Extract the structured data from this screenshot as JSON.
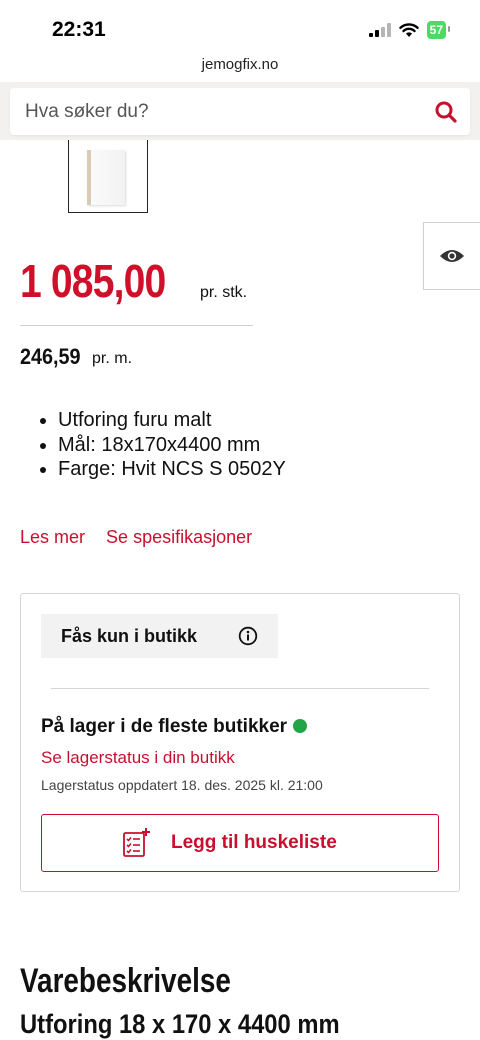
{
  "status_bar": {
    "time": "22:31",
    "battery": "57"
  },
  "browser": {
    "url": "jemogfix.no"
  },
  "search": {
    "placeholder": "Hva søker du?"
  },
  "product": {
    "price": "1 085,00",
    "price_unit": "pr. stk.",
    "price_per_meter": "246,59",
    "price_per_meter_unit": "pr. m.",
    "features": [
      "Utforing furu malt",
      "Mål: 18x170x4400 mm",
      "Farge: Hvit NCS S 0502Y"
    ],
    "links": {
      "read_more": "Les mer",
      "specifications": "Se spesifikasjoner"
    }
  },
  "availability": {
    "store_only": "Fås kun i butikk",
    "stock_title": "På lager i de fleste butikker",
    "stock_link": "Se lagerstatus i din butikk",
    "stock_updated": "Lagerstatus oppdatert 18. des. 2025 kl. 21:00",
    "wishlist_button": "Legg til huskeliste"
  },
  "description": {
    "heading": "Varebeskrivelse",
    "subheading": "Utforing 18 x 170 x 4400 mm"
  },
  "colors": {
    "accent_red": "#c8102e",
    "price_red": "#d0102a",
    "stock_green": "#22a447"
  }
}
